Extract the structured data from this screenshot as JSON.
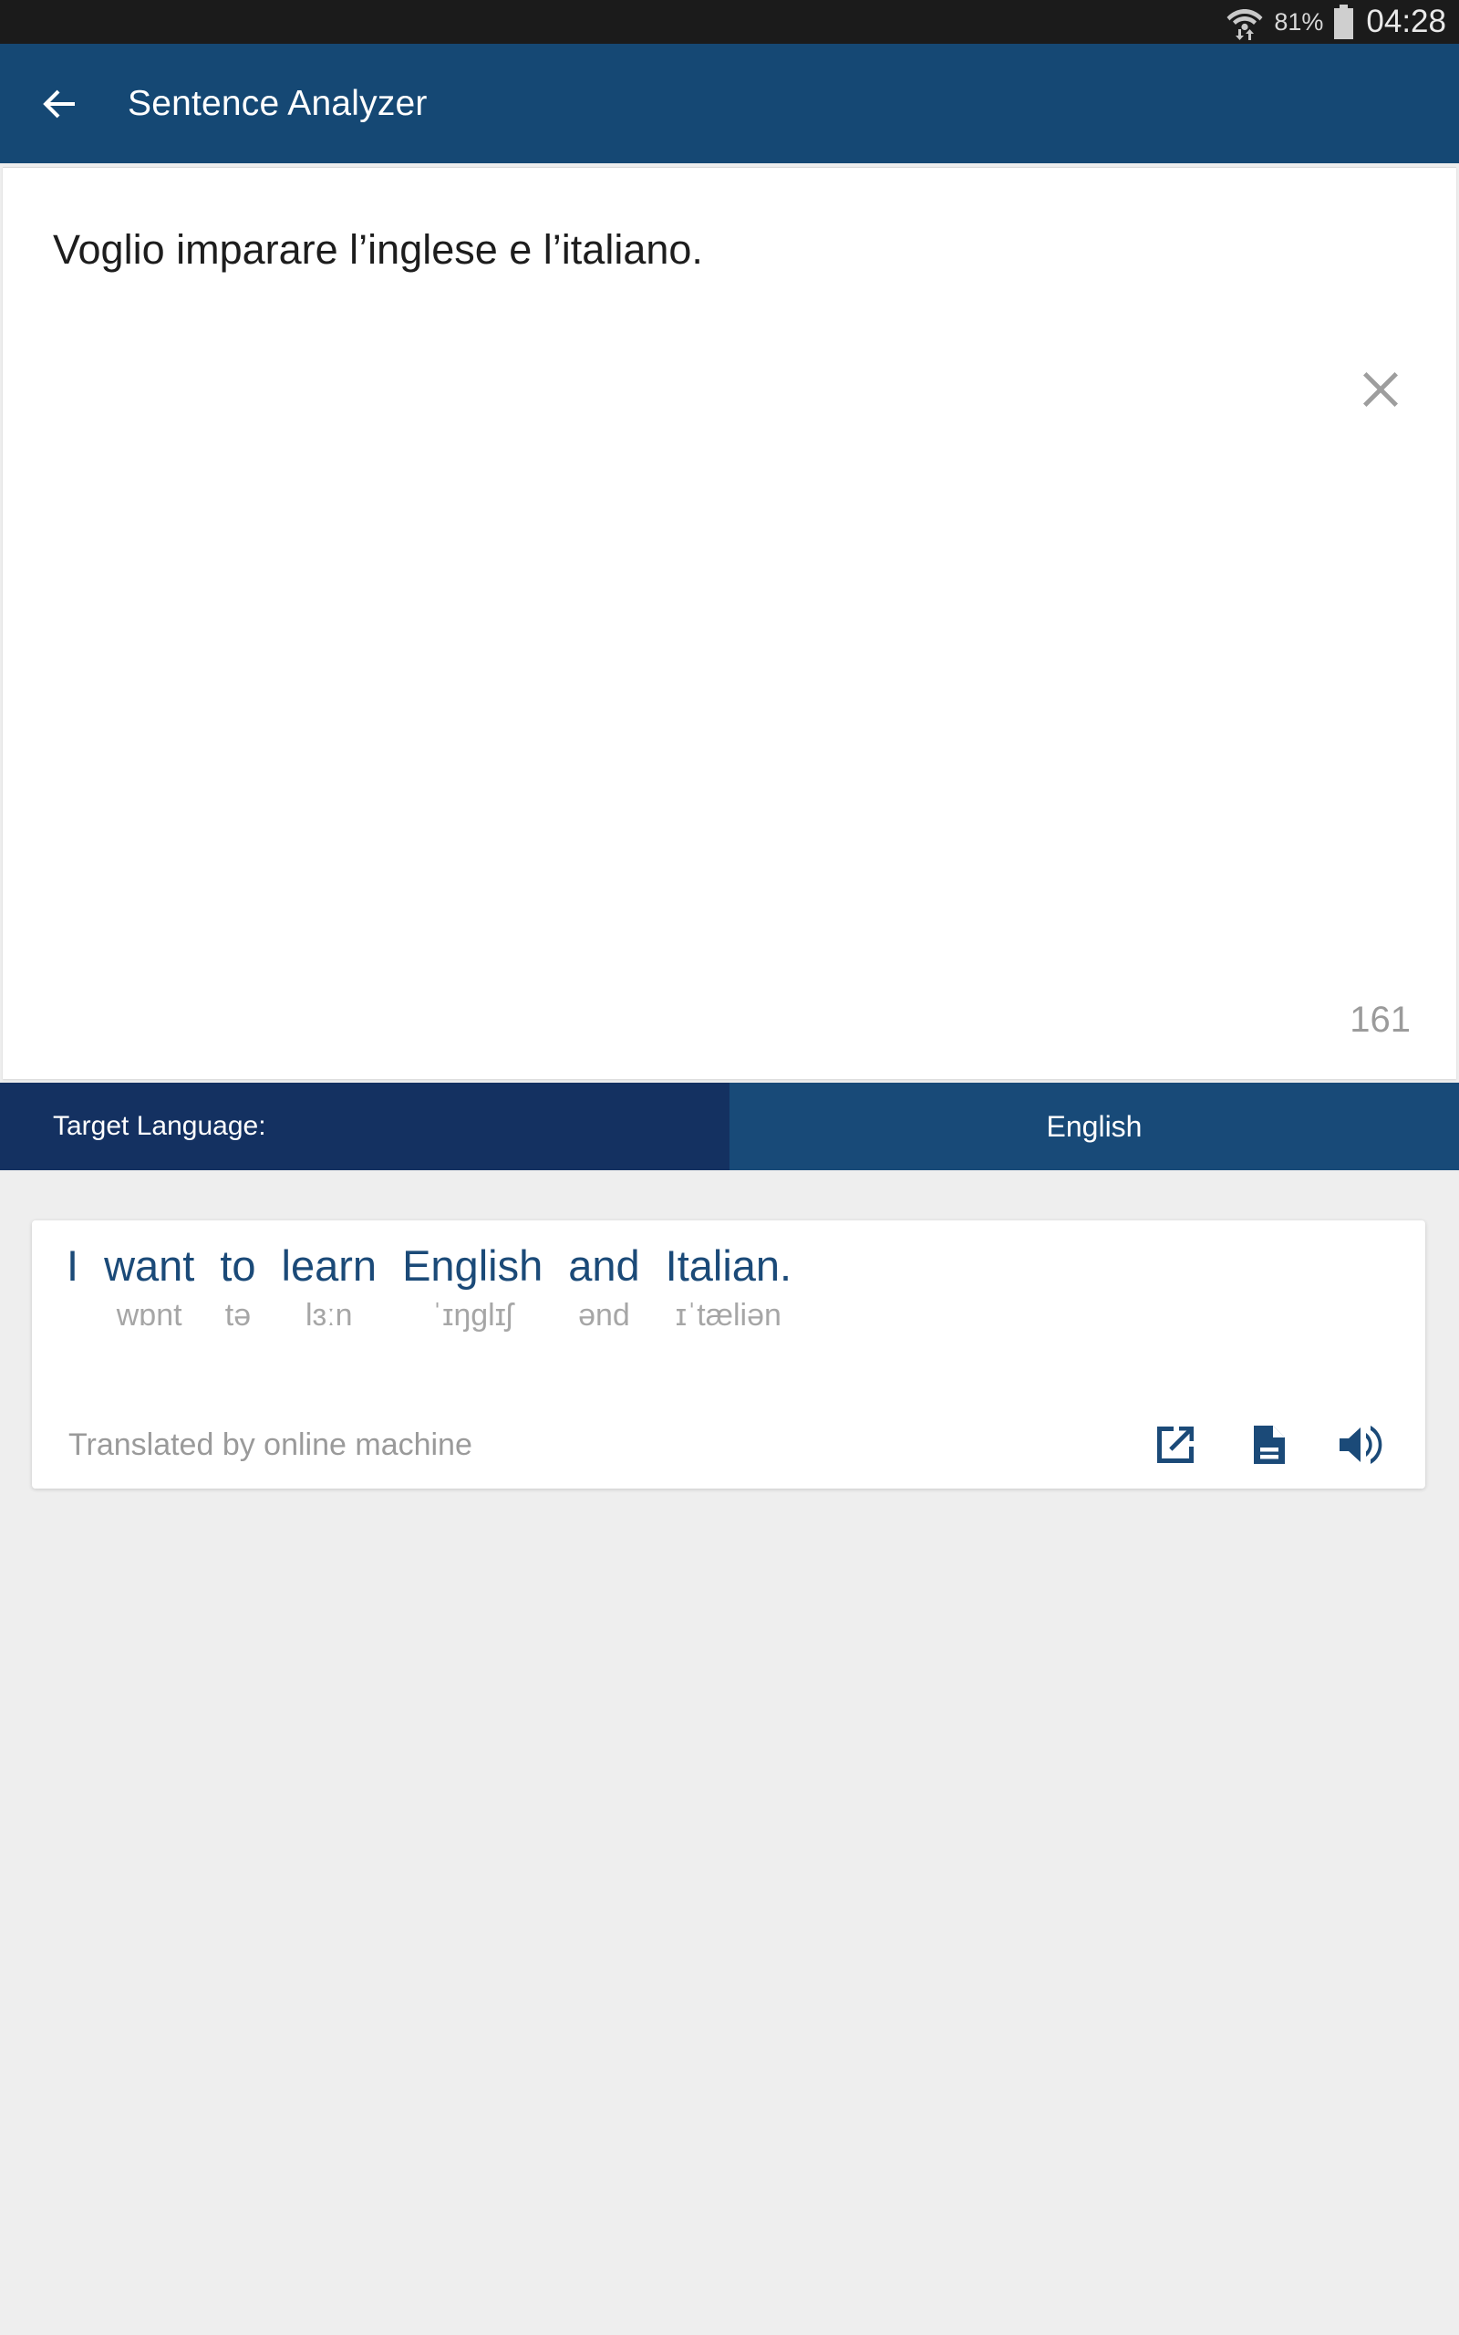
{
  "status_bar": {
    "wifi_icon": "wifi-with-data-transfer-icon",
    "battery_percent": "81%",
    "battery_icon": "battery-icon",
    "time": "04:28"
  },
  "app_bar": {
    "back_icon": "arrow-back-icon",
    "title": "Sentence Analyzer",
    "background_color": "#154874"
  },
  "input_card": {
    "text": "Voglio imparare l’inglese e l’italiano.",
    "clear_icon": "close-icon",
    "char_count": "161"
  },
  "language_bar": {
    "label": "Target Language:",
    "value": "English",
    "label_bg": "#143161",
    "value_bg": "#184a78"
  },
  "translation_card": {
    "words": [
      {
        "text": "I",
        "ipa": ""
      },
      {
        "text": "want",
        "ipa": "wɒnt"
      },
      {
        "text": "to",
        "ipa": "tə"
      },
      {
        "text": "learn",
        "ipa": "lɜːn"
      },
      {
        "text": "English",
        "ipa": "ˈɪŋglɪʃ"
      },
      {
        "text": "and",
        "ipa": "ənd"
      },
      {
        "text": "Italian.",
        "ipa": "ɪˈtæliən"
      }
    ],
    "source_note": "Translated by online machine",
    "actions": [
      {
        "icon": "open-in-new-icon",
        "label": "Open in new"
      },
      {
        "icon": "document-icon",
        "label": "Document"
      },
      {
        "icon": "volume-up-icon",
        "label": "Speak"
      }
    ],
    "accent_color": "#1b4a78"
  }
}
